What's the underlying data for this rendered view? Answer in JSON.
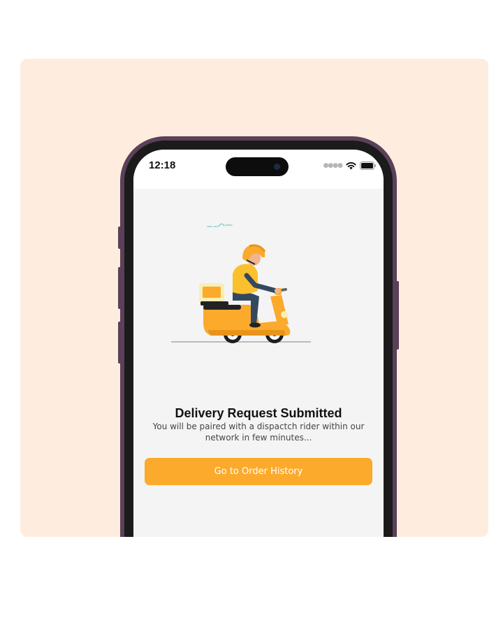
{
  "status_bar": {
    "time": "12:18",
    "icons": [
      "cellular-signal-icon",
      "wifi-icon",
      "battery-icon"
    ]
  },
  "confirmation": {
    "illustration": "delivery-rider-scooter-illustration",
    "title": "Delivery Request Submitted",
    "message": "You will be paired with a dispactch rider within our network in few minutes...",
    "button_label": "Go to Order History"
  },
  "colors": {
    "accent": "#FBAA2C",
    "card_background": "#FEEDDE",
    "screen_background": "#F4F4F4",
    "phone_frame": "#5A4058"
  }
}
